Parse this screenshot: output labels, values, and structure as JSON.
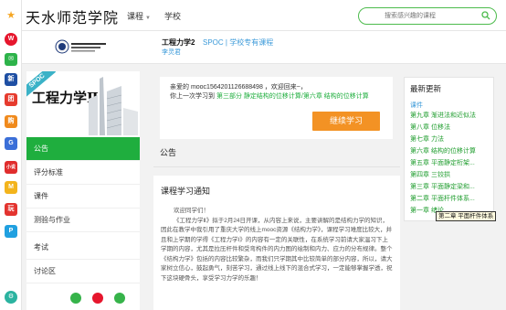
{
  "site": {
    "name": "天水师范学院"
  },
  "nav": {
    "course": "课程",
    "school": "学校"
  },
  "search": {
    "placeholder": "搜索感兴趣的课程"
  },
  "course": {
    "title": "工程力学2",
    "spoc_label": "SPOC | 学校专有课程",
    "teacher": "李灵君",
    "cover_title": "工程力学Ⅱ",
    "cover_ribbon": "SPOC"
  },
  "sidebar": {
    "items": [
      {
        "label": "公告"
      },
      {
        "label": "评分标准"
      },
      {
        "label": "课件"
      },
      {
        "label": "测验与作业"
      },
      {
        "label": "考试"
      },
      {
        "label": "讨论区"
      }
    ]
  },
  "welcome": {
    "line1": "亲爱的 mooc1564201126688498 ，欢迎回来~，",
    "line2_prefix": "你上一次学习到 ",
    "line2_link": "第三部分 静定结构的位移计算/第六章 结构的位移计算",
    "continue_label": "继续学习"
  },
  "notice": {
    "section": "公告",
    "title": "课程学习通知",
    "greeting": "欢迎同学们！",
    "body": "《工程力学Ⅱ》拟于2月24日开课，从内容上来说，主要讲解的是结构力学的知识，因此在教学中我引用了重庆大学的线上mooc资源《结构力学》，课程学习难度比较大，并且和上学期的学得《工程力学Ⅰ》的内容有一定的关联性，在系统学习前请大家温习下上学期的内容，尤其是拉压杆件和受弯构件的内力图的绘制和内力、应力的分布规律。整个《结构力学》包括的内容比较繁杂，而我们只学期其中比较简单的部分内容，所以，请大家树立信心，鼓起勇气，刻苦学习，通过线上线下的混合式学习，一定能够掌握学透，祝下这块硬骨头，享受学习力学的乐趣！"
  },
  "updates": {
    "title": "最新更新",
    "category": "课件",
    "items": [
      "第九章 渐进法和近似法",
      "第八章 位移法",
      "第七章 力法",
      "第六章 结构的位移计算",
      "第五章 平面静定桁架...",
      "第四章 三铰拱",
      "第三章 平面静定梁和...",
      "第二章 平面杆件体系...",
      "第一章 绪论"
    ],
    "tooltip": "第二章 平面杆件体系"
  },
  "colors": {
    "accent": "#1fae3e",
    "link": "#3b9ad9",
    "button": "#f39224"
  }
}
